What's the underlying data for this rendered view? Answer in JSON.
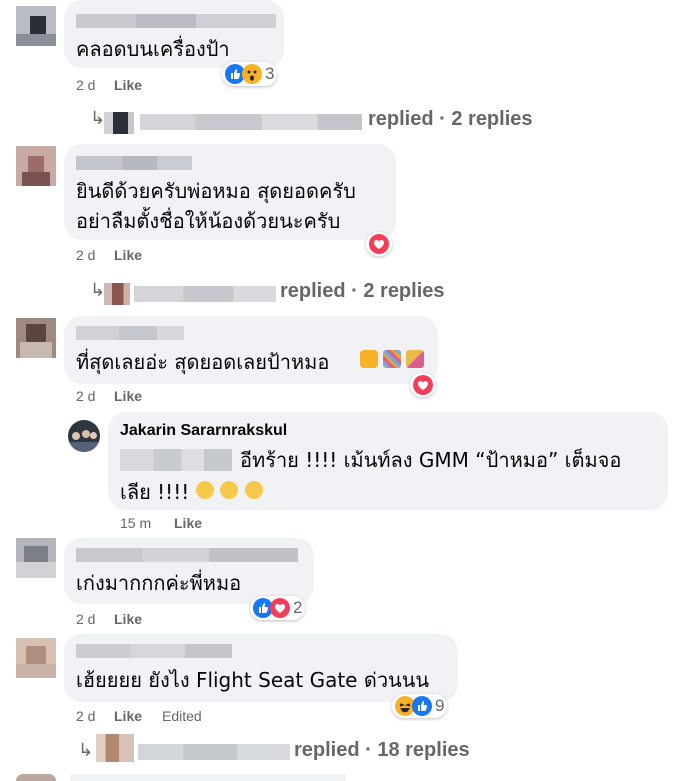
{
  "comments": [
    {
      "text": "คลอดบนเครื่องป้า",
      "time": "2 d",
      "like": "Like",
      "reaction_count": "3",
      "replied": "replied · 2 replies"
    },
    {
      "text_line1": "ยินดีด้วยครับพ่อหมอ สุดยอดครับ",
      "text_line2": "อย่าลืมตั้งชื่อให้น้องด้วยนะครับ",
      "time": "2 d",
      "like": "Like",
      "replied": "replied · 2 replies"
    },
    {
      "text": "ที่สุดเลยอ่ะ สุดยอดเลยป้าหมอ",
      "time": "2 d",
      "like": "Like"
    },
    {
      "text": "เก่งมากกกค่ะพี่หมอ",
      "time": "2 d",
      "like": "Like",
      "reaction_count": "2"
    },
    {
      "text": "เฮ้ยยยย ยังไง Flight Seat Gate ด่วนนน",
      "time": "2 d",
      "like": "Like",
      "edited": "Edited",
      "reaction_count": "9",
      "replied": "replied · 18 replies"
    }
  ],
  "reply": {
    "author": "Jakarin Sararnrakskul",
    "line1": "อีทร้าย !!!! เม้นท์ลง GMM “ป้าหมอ” เต็มจอ",
    "line2": "เลีย !!!!",
    "time": "15 m",
    "like": "Like"
  },
  "colors": {
    "bubble": "#f0f2f5",
    "meta": "#65676b",
    "text": "#050505",
    "like_blue": "#1877f2",
    "love_red": "#f33e58",
    "emoji_yellow": "#f7b125"
  }
}
